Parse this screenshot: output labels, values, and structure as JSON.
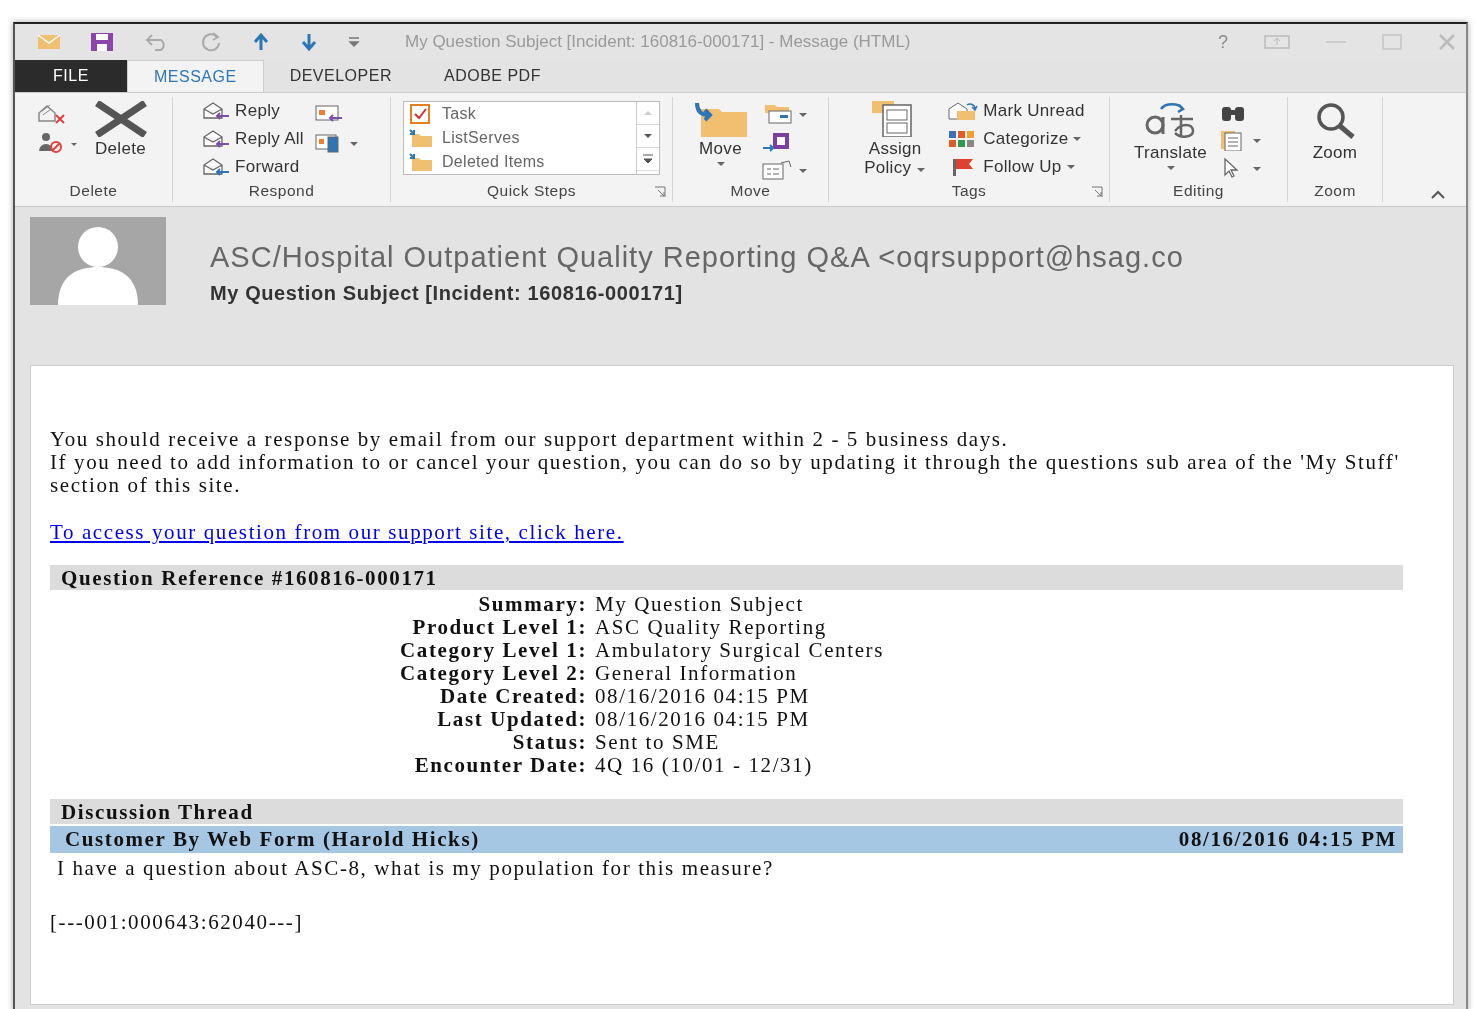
{
  "window": {
    "title": "My Question Subject [Incident: 160816-000171] - Message (HTML)",
    "help": "?"
  },
  "tabs": [
    {
      "label": "FILE",
      "selected": false,
      "kind": "file"
    },
    {
      "label": "MESSAGE",
      "selected": true,
      "kind": "tab"
    },
    {
      "label": "DEVELOPER",
      "selected": false,
      "kind": "tab"
    },
    {
      "label": "ADOBE PDF",
      "selected": false,
      "kind": "tab"
    }
  ],
  "ribbon": [
    {
      "label": "Delete",
      "buttons": [
        {
          "label": "Delete"
        }
      ]
    },
    {
      "label": "Respond",
      "buttons": [
        {
          "label": "Reply"
        },
        {
          "label": "Reply All"
        },
        {
          "label": "Forward"
        }
      ]
    },
    {
      "label": "Quick Steps",
      "steps": [
        {
          "label": "Task"
        },
        {
          "label": "ListServes"
        },
        {
          "label": "Deleted Items"
        }
      ]
    },
    {
      "label": "Move",
      "buttons": [
        {
          "label": "Move"
        }
      ]
    },
    {
      "label": "Tags",
      "buttons": [
        {
          "label": "Assign Policy"
        },
        {
          "label": "Mark Unread"
        },
        {
          "label": "Categorize"
        },
        {
          "label": "Follow Up"
        }
      ]
    },
    {
      "label": "Editing",
      "buttons": [
        {
          "label": "Translate"
        }
      ]
    },
    {
      "label": "Zoom",
      "buttons": [
        {
          "label": "Zoom"
        }
      ]
    }
  ],
  "header": {
    "sender": "ASC/Hospital Outpatient Quality Reporting Q&A <oqrsupport@hsag.co",
    "subject": "My Question Subject [Incident: 160816-000171]"
  },
  "body": {
    "paragraphs": [
      "You should receive a response by email from our support department within 2 - 5 business days.",
      "If you need to add information to or cancel your question, you can do so by updating it through the questions sub area of the 'My Stuff' section of this site."
    ],
    "link": "To access your question from our support site, click here.",
    "reference": {
      "title": "Question Reference #160816-000171",
      "fields": [
        {
          "label": "Summary:",
          "value": "My Question Subject"
        },
        {
          "label": "Product Level 1:",
          "value": "ASC Quality Reporting"
        },
        {
          "label": "Category Level 1:",
          "value": "Ambulatory Surgical Centers"
        },
        {
          "label": "Category Level 2:",
          "value": "General Information"
        },
        {
          "label": "Date Created:",
          "value": "08/16/2016 04:15 PM"
        },
        {
          "label": "Last Updated:",
          "value": "08/16/2016 04:15 PM"
        },
        {
          "label": "Status:",
          "value": "Sent to SME"
        },
        {
          "label": "Encounter Date:",
          "value": "4Q 16 (10/01 - 12/31)"
        }
      ]
    },
    "thread": {
      "title": "Discussion Thread",
      "entries": [
        {
          "author": "Customer By Web Form (Harold Hicks)",
          "date": "08/16/2016 04:15 PM",
          "message": "I have a question about ASC-8, what is my population for this measure?"
        }
      ],
      "code": "[---001:000643:62040---]"
    }
  }
}
